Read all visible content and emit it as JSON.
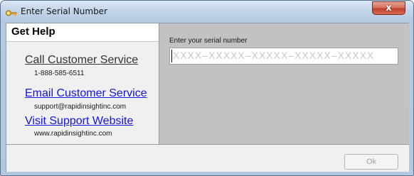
{
  "window": {
    "title": "Enter Serial Number",
    "close_label": "x"
  },
  "help": {
    "title": "Get Help",
    "items": [
      {
        "title": "Call Customer Service",
        "detail": "1-888-585-6511",
        "link": false
      },
      {
        "title": "Email Customer Service",
        "detail": "support@rapidinsightinc.com",
        "link": true
      },
      {
        "title": "Visit Support Website",
        "detail": "www.rapidinsightinc.com",
        "link": true
      }
    ]
  },
  "serial": {
    "label": "Enter your serial number",
    "placeholder": "XXXX–XXXXX–XXXXX–XXXXX–XXXXX",
    "value": ""
  },
  "footer": {
    "ok_label": "Ok",
    "ok_enabled": false
  },
  "colors": {
    "link": "#1414e6",
    "serial_panel_bg": "#c2c2c2",
    "close_button": "#c0412b"
  }
}
